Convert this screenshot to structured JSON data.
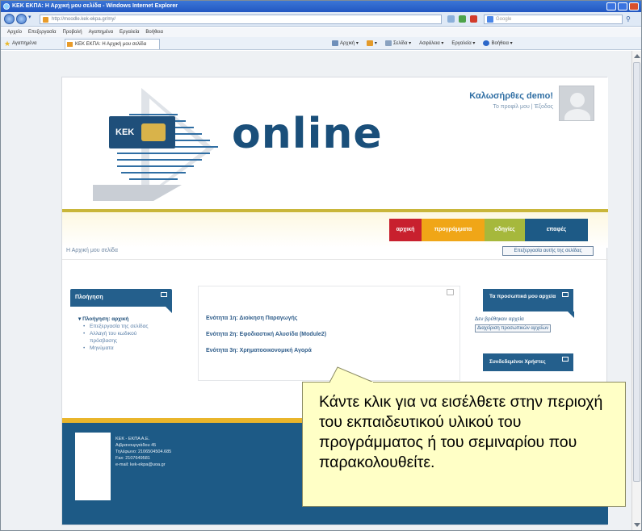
{
  "browser": {
    "window_title": "ΚΕΚ ΕΚΠΑ: Η Αρχική μου σελίδα - Windows Internet Explorer",
    "address": "http://moodle.kek-ekpa.gr/my/",
    "search_placeholder": "Google",
    "menu": [
      "Αρχείο",
      "Επεξεργασία",
      "Προβολή",
      "Αγαπημένα",
      "Εργαλεία",
      "Βοήθεια"
    ],
    "favorites_label": "Αγαπημένα",
    "tab_title": "ΚΕΚ ΕΚΠΑ: Η Αρχική μου σελίδα",
    "commands": [
      "Αρχική",
      "Σελίδα",
      "Ασφάλεια",
      "Εργαλεία",
      "Βοήθεια"
    ]
  },
  "site": {
    "brand_badge": "ΚΕΚ",
    "logo_text": "online",
    "welcome": "Καλωσήρθες demo!",
    "welcome_sub": "Το προφίλ μου | Έξοδος",
    "nav": [
      {
        "label": "αρχική",
        "color": "#c8202e"
      },
      {
        "label": "προγράμματα",
        "color": "#f0a617"
      },
      {
        "label": "οδηγίες",
        "color": "#a6b83c"
      },
      {
        "label": "επαφές",
        "color": "#1d5a86"
      }
    ],
    "breadcrumb": "Η Αρχική μου σελίδα",
    "edit_button": "Επεξεργασία αυτής της σελίδας"
  },
  "left_block": {
    "title": "Πλοήγηση",
    "root": "Πλοήγηση: αρχική",
    "items": [
      "Επεξεργασία της σελίδας",
      "Αλλαγή του κωδικού πρόσβασης",
      "Μηνύματα"
    ]
  },
  "courses": [
    "Ενότητα 1η: Διοίκηση Παραγωγής",
    "Ενότητα 2η: Εφοδιαστική Αλυσίδα (Module2)",
    "Ενότητα 3η: Χρηματοοικονομική Αγορά"
  ],
  "right_blocks": {
    "materials_title": "Τα προσωπικά μου αρχεία",
    "materials_text": "Δεν βρέθηκαν αρχεία",
    "materials_button": "Διαχείριση προσωπικών αρχείων",
    "users_title": "Συνδεδεμένοι Χρήστες"
  },
  "footer": {
    "lines": [
      "ΚΕΚ - ΕΚΠΑ Α.Ε.",
      "Αιβρανουργιάδου 45",
      "Τηλέφωνο: 2106504504.685",
      "Fax: 2107649581",
      "e-mail: kek-ekpa@uoa.gr"
    ]
  },
  "callout": {
    "text": "Κάντε κλικ για να εισέλθετε στην περιοχή του εκπαιδευτικού υλικού του προγράμματος ή του σεμιναρίου που παρακολουθείτε."
  }
}
